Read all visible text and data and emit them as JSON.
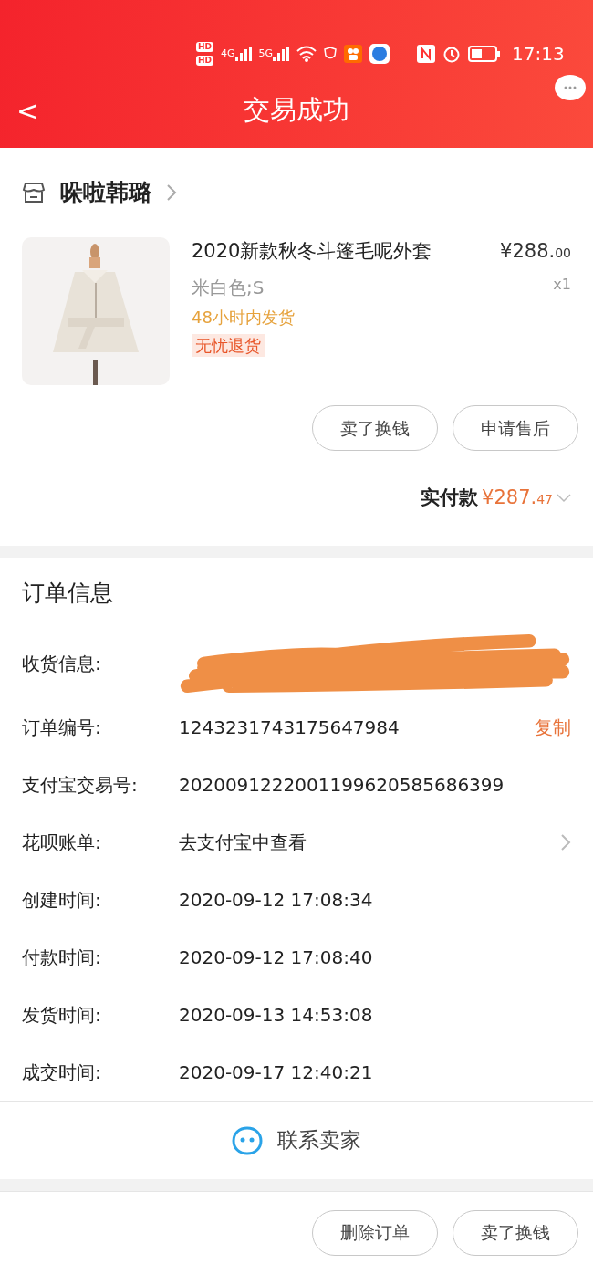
{
  "status_bar": {
    "sim_labels": [
      "HD",
      "HD"
    ],
    "network_labels": [
      "4G",
      "5G"
    ],
    "time": "17:13"
  },
  "header": {
    "back": "<",
    "title": "交易成功"
  },
  "store": {
    "name": "哚啦韩璐"
  },
  "product": {
    "kind": "picture",
    "title": "2020新款秋冬斗篷毛呢外套",
    "price_main": "¥288.",
    "price_cents": "00",
    "quantity": "x1",
    "variant": "米白色;S",
    "shipping_note": "48小时内发货",
    "tag": "无忧退货"
  },
  "item_buttons": [
    "卖了换钱",
    "申请售后"
  ],
  "payment": {
    "label": "实付款",
    "amount_main": "¥287.",
    "amount_cents": "47"
  },
  "order_info": {
    "title": "订单信息",
    "rows": [
      {
        "kind": "redacted",
        "label": "收货信息:"
      },
      {
        "kind": "copy",
        "label": "订单编号:",
        "value": "1243231743175647984",
        "action": "复制"
      },
      {
        "kind": "plain",
        "label": "支付宝交易号:",
        "value": "2020091222001199620585686399"
      },
      {
        "kind": "link",
        "label": "花呗账单:",
        "value": "去支付宝中查看"
      },
      {
        "kind": "plain",
        "label": "创建时间:",
        "value": "2020-09-12 17:08:34"
      },
      {
        "kind": "plain",
        "label": "付款时间:",
        "value": "2020-09-12 17:08:40"
      },
      {
        "kind": "plain",
        "label": "发货时间:",
        "value": "2020-09-13 14:53:08"
      },
      {
        "kind": "plain",
        "label": "成交时间:",
        "value": "2020-09-17 12:40:21"
      }
    ]
  },
  "contact": {
    "label": "联系卖家"
  },
  "footer_buttons": [
    "删除订单",
    "卖了换钱"
  ]
}
